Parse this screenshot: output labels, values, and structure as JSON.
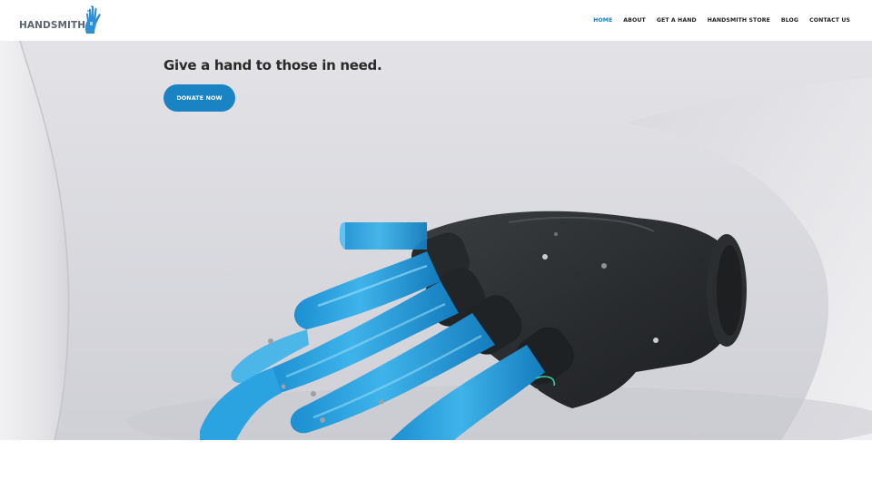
{
  "brand": {
    "name": "HANDSMITH",
    "accent": "#1a83c4",
    "logo_icon": "hand-logo-icon"
  },
  "nav": {
    "items": [
      {
        "label": "HOME",
        "active": true
      },
      {
        "label": "ABOUT",
        "active": false
      },
      {
        "label": "GET A HAND",
        "active": false
      },
      {
        "label": "HANDSMITH STORE",
        "active": false
      },
      {
        "label": "BLOG",
        "active": false
      },
      {
        "label": "CONTACT US",
        "active": false
      }
    ]
  },
  "hero": {
    "title": "Give a hand to those in need.",
    "button_label": "DONATE NOW",
    "button_color": "#1a83c4"
  }
}
